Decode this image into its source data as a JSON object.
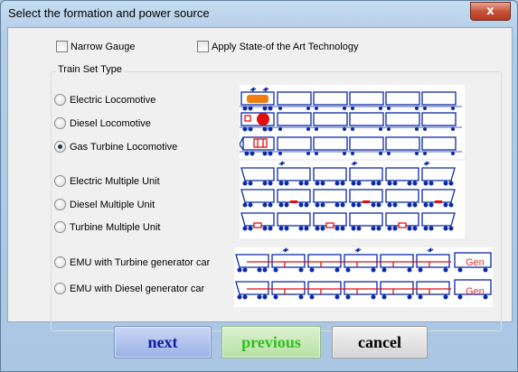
{
  "window": {
    "title": "Select the formation and power source",
    "close_label": "x"
  },
  "options": {
    "narrow_gauge": "Narrow Gauge",
    "state_of_art": "Apply State-of the Art Technology"
  },
  "group": {
    "label": "Train Set Type",
    "items": [
      {
        "label": "Electric Locomotive",
        "selected": false
      },
      {
        "label": "Diesel  Locomotive",
        "selected": false
      },
      {
        "label": "Gas Turbine  Locomotive",
        "selected": true
      },
      {
        "label": "Electric Multiple Unit",
        "selected": false
      },
      {
        "label": "Diesel Multiple Unit",
        "selected": false
      },
      {
        "label": "Turbine Multiple Unit",
        "selected": false
      },
      {
        "label": "EMU with Turbine generator car",
        "selected": false
      },
      {
        "label": "EMU with Diesel generator car",
        "selected": false
      }
    ],
    "gen_label": "Gen"
  },
  "buttons": {
    "next": "next",
    "previous": "previous",
    "cancel": "cancel"
  },
  "colors": {
    "train_blue": "#0a2aa8",
    "loco_orange": "#f07d10",
    "loco_red": "#e01010",
    "gen_red": "#e83030",
    "next_text": "#0d1aa0",
    "previous_text": "#2ec21a"
  }
}
